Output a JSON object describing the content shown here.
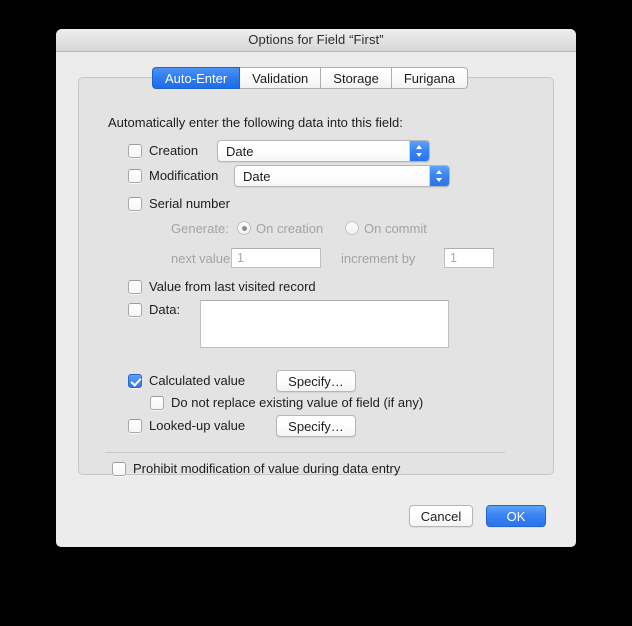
{
  "window": {
    "title": "Options for Field “First”"
  },
  "tabs": [
    {
      "label": "Auto-Enter",
      "selected": true
    },
    {
      "label": "Validation",
      "selected": false
    },
    {
      "label": "Storage",
      "selected": false
    },
    {
      "label": "Furigana",
      "selected": false
    }
  ],
  "panel": {
    "intro": "Automatically enter the following data into this field:",
    "creation": {
      "label": "Creation",
      "checked": false,
      "popup_value": "Date"
    },
    "modification": {
      "label": "Modification",
      "checked": false,
      "popup_value": "Date"
    },
    "serial_number": {
      "label": "Serial number",
      "checked": false,
      "generate_label": "Generate:",
      "on_creation_label": "On creation",
      "on_creation_selected": true,
      "on_commit_label": "On commit",
      "on_commit_selected": false,
      "next_value_label": "next value",
      "next_value": "1",
      "increment_by_label": "increment by",
      "increment_by": "1"
    },
    "value_from_last_visited": {
      "label": "Value from last visited record",
      "checked": false
    },
    "data": {
      "label": "Data:",
      "checked": false,
      "value": ""
    },
    "calculated_value": {
      "label": "Calculated value",
      "checked": true,
      "specify_label": "Specify…"
    },
    "do_not_replace": {
      "label": "Do not replace existing value of field (if any)",
      "checked": false
    },
    "looked_up_value": {
      "label": "Looked-up value",
      "checked": false,
      "specify_label": "Specify…"
    },
    "prohibit": {
      "label": "Prohibit modification of value during data entry",
      "checked": false
    }
  },
  "footer": {
    "cancel_label": "Cancel",
    "ok_label": "OK"
  },
  "colors": {
    "accent": "#3277ee",
    "window_bg": "#ececec",
    "panel_bg": "#e3e3e3",
    "text": "#1d1d1d",
    "disabled_text": "#a3a3a3"
  }
}
